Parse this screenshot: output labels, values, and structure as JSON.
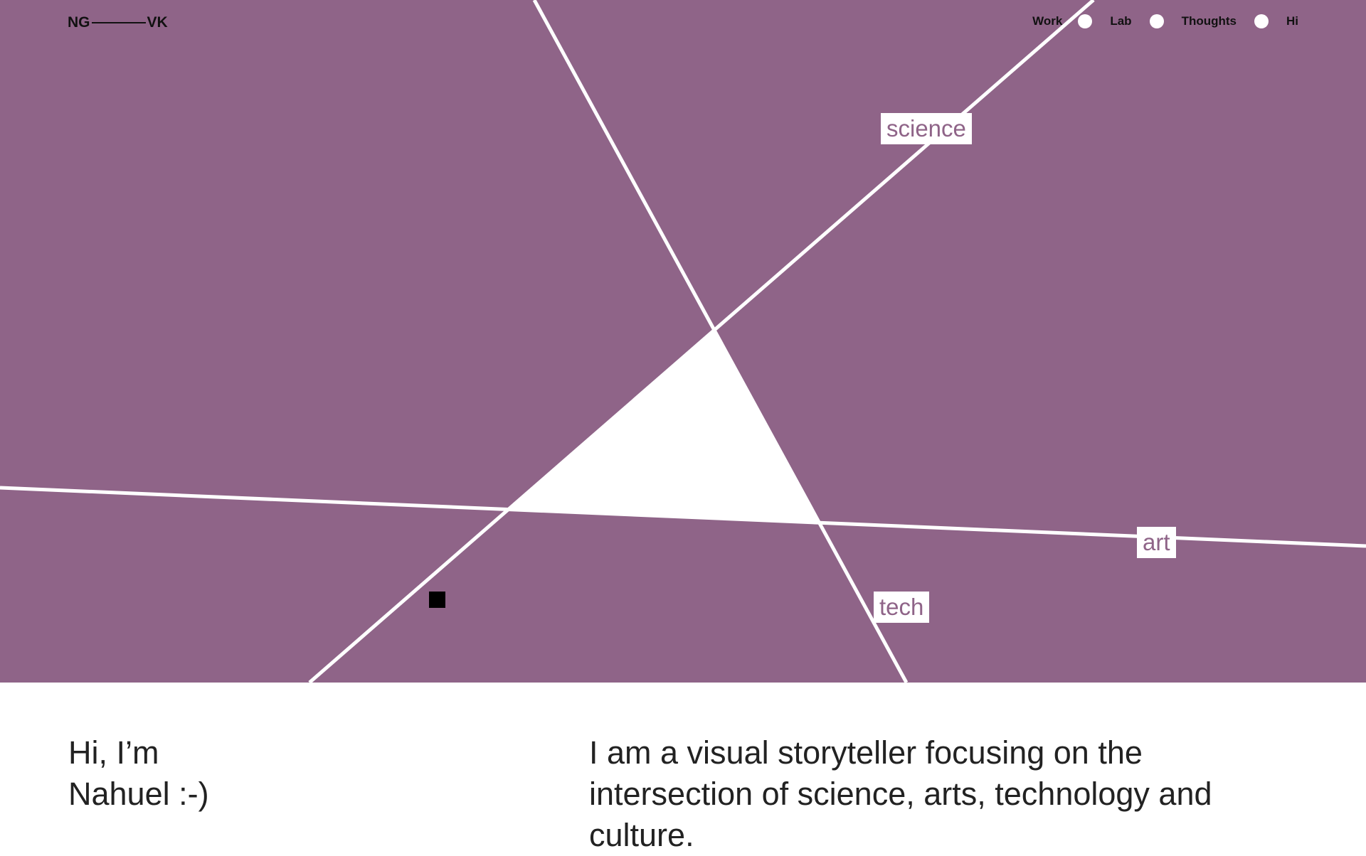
{
  "colors": {
    "hero_background": "#8f6488",
    "lines": "#ffffff",
    "tag_text": "#8f6488",
    "body_text": "#222222"
  },
  "header": {
    "logo_left": "NG",
    "logo_right": "VK",
    "nav": [
      {
        "label": "Work"
      },
      {
        "label": "Lab"
      },
      {
        "label": "Thoughts"
      },
      {
        "label": "Hi"
      }
    ]
  },
  "hero": {
    "tags": {
      "science": "science",
      "art": "art",
      "tech": "tech"
    }
  },
  "intro": {
    "line1": "Hi, I’m",
    "line2": "Nahuel :-)",
    "bio": "I am a visual storyteller focusing on the intersection of science, arts, technology and culture."
  }
}
